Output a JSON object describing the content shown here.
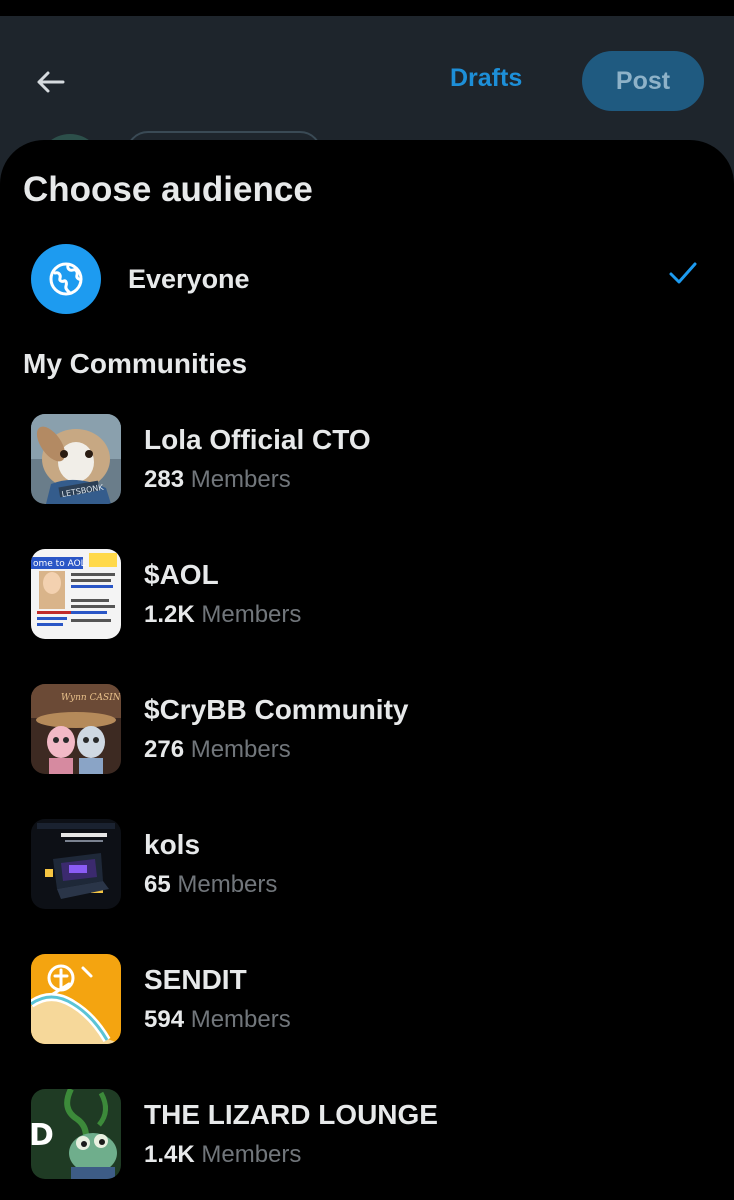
{
  "header": {
    "back_icon": "arrow-left-icon",
    "drafts_label": "Drafts",
    "post_label": "Post"
  },
  "sheet": {
    "title": "Choose audience",
    "everyone": {
      "label": "Everyone",
      "icon": "globe-icon",
      "selected": true
    },
    "section_title": "My Communities",
    "communities": [
      {
        "name": "Lola Official CTO",
        "count": "283",
        "suffix": "Members",
        "thumb": "bunny-in-shirt-image"
      },
      {
        "name": "$AOL",
        "count": "1.2K",
        "suffix": "Members",
        "thumb": "aol-webpage-image"
      },
      {
        "name": "$CryBB Community",
        "count": "276",
        "suffix": "Members",
        "thumb": "casino-dolls-image"
      },
      {
        "name": "kols",
        "count": "65",
        "suffix": "Members",
        "thumb": "trading-dashboard-image"
      },
      {
        "name": "SENDIT",
        "count": "594",
        "suffix": "Members",
        "thumb": "sendit-logo-image"
      },
      {
        "name": "THE LIZARD LOUNGE",
        "count": "1.4K",
        "suffix": "Members",
        "thumb": "lizard-image"
      }
    ]
  },
  "colors": {
    "accent": "#1d9bf0",
    "background": "#000000",
    "header_bg": "#1e252c",
    "muted_text": "#71767b"
  }
}
